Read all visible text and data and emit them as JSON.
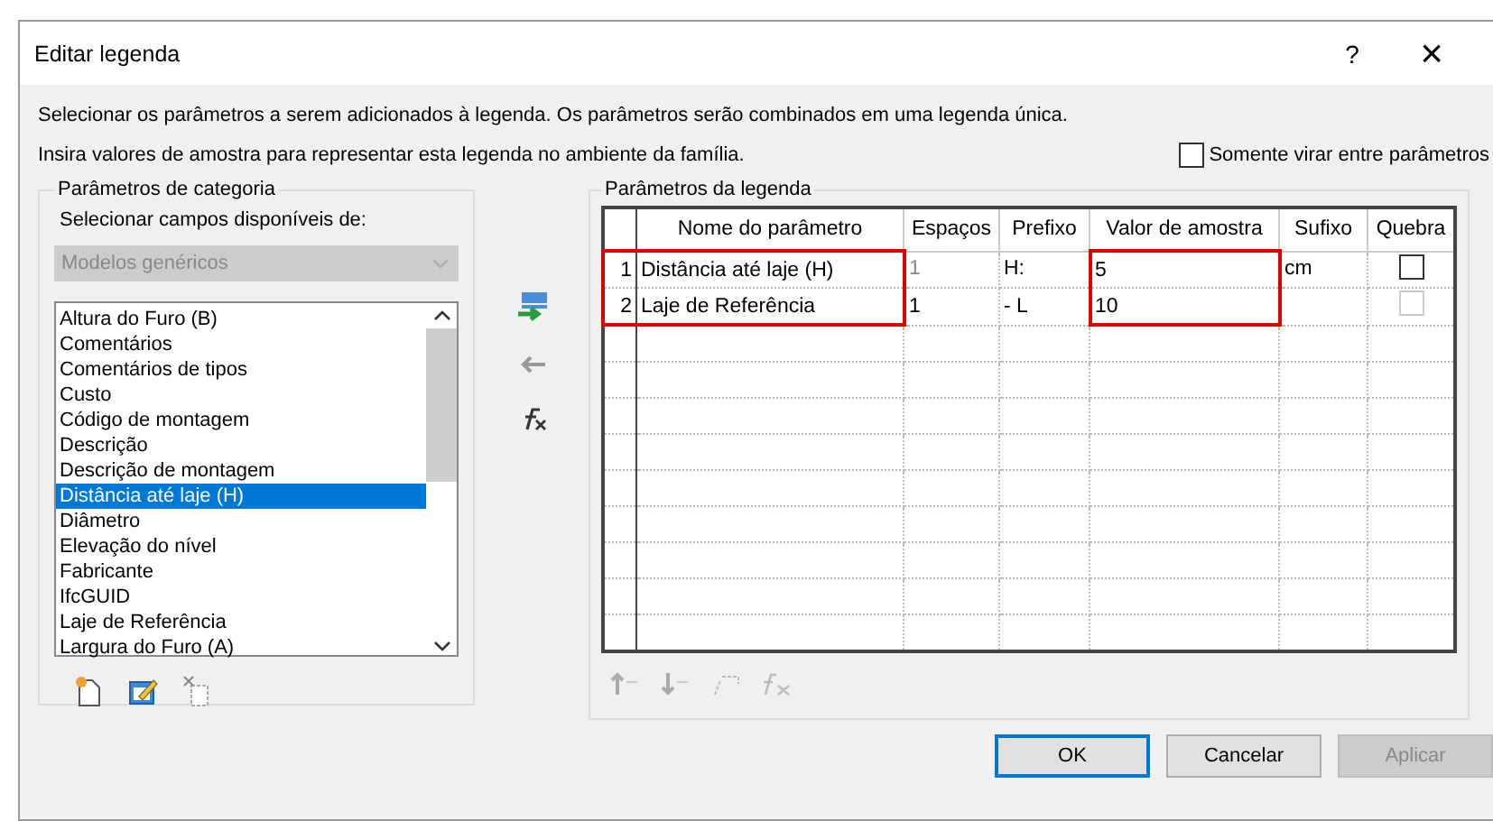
{
  "window": {
    "title": "Editar legenda",
    "help": "?",
    "close": "×"
  },
  "instructions": [
    "Selecionar os parâmetros a serem adicionados à legenda. Os parâmetros serão combinados em uma legenda única.",
    "Insira valores de amostra para representar esta legenda no ambiente da família."
  ],
  "flip_option": {
    "label": "Somente virar entre parâmetros",
    "checked": false
  },
  "category": {
    "title": "Parâmetros de categoria",
    "select_label": "Selecionar campos disponíveis de:",
    "dropdown": {
      "value": "Modelos genéricos",
      "disabled": true
    },
    "items": [
      {
        "label": "Altura do Furo (B)",
        "selected": false
      },
      {
        "label": "Comentários",
        "selected": false
      },
      {
        "label": "Comentários de tipos",
        "selected": false
      },
      {
        "label": "Custo",
        "selected": false
      },
      {
        "label": "Código de montagem",
        "selected": false
      },
      {
        "label": "Descrição",
        "selected": false
      },
      {
        "label": "Descrição de montagem",
        "selected": false
      },
      {
        "label": "Distância até laje (H)",
        "selected": true
      },
      {
        "label": "Diâmetro",
        "selected": false
      },
      {
        "label": "Elevação do nível",
        "selected": false
      },
      {
        "label": "Fabricante",
        "selected": false
      },
      {
        "label": "IfcGUID",
        "selected": false
      },
      {
        "label": "Laje de Referência",
        "selected": false
      },
      {
        "label": "Largura do Furo (A)",
        "selected": false
      }
    ]
  },
  "legend": {
    "title": "Parâmetros da legenda",
    "columns": [
      {
        "label": "Nome do parâmetro",
        "highlighted": true
      },
      {
        "label": "Espaços",
        "highlighted": false
      },
      {
        "label": "Prefixo",
        "highlighted": false
      },
      {
        "label": "Valor de amostra",
        "highlighted": true
      },
      {
        "label": "Sufixo",
        "highlighted": false
      },
      {
        "label": "Quebra",
        "highlighted": false
      }
    ],
    "rows": [
      {
        "number": "1",
        "name": "Distância até laje (H)",
        "spaces": "1",
        "spaces_disabled": true,
        "prefix": "H:",
        "sample": "5",
        "suffix": "cm",
        "break": false,
        "break_disabled": false
      },
      {
        "number": "2",
        "name": "Laje de Referência",
        "spaces": "1",
        "spaces_disabled": false,
        "prefix": "- L",
        "sample": "10",
        "suffix": "",
        "break": false,
        "break_disabled": true
      }
    ]
  },
  "buttons": [
    {
      "label": "OK",
      "kind": "default"
    },
    {
      "label": "Cancelar",
      "kind": "normal"
    },
    {
      "label": "Aplicar",
      "kind": "disabled"
    }
  ]
}
